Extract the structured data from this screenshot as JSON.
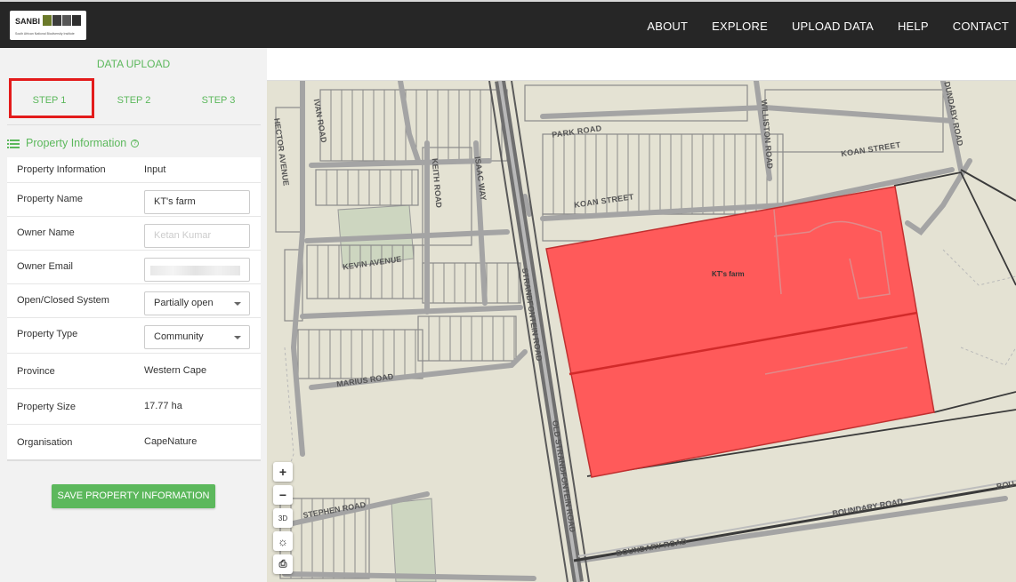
{
  "header": {
    "logo_abbr": "SANBI",
    "logo_sub": "South African National Biodiversity Institute",
    "nav": [
      "ABOUT",
      "EXPLORE",
      "UPLOAD DATA",
      "HELP",
      "CONTACT"
    ]
  },
  "panel": {
    "title": "DATA UPLOAD",
    "steps": [
      "STEP 1",
      "STEP 2",
      "STEP 3"
    ],
    "section_title": "Property Information",
    "table_head": {
      "label": "Property Information",
      "value": "Input"
    },
    "rows": [
      {
        "label": "Property Name",
        "value": "KT's farm"
      },
      {
        "label": "Owner Name",
        "value": "Ketan Kumar"
      },
      {
        "label": "Owner Email",
        "value": ""
      },
      {
        "label": "Open/Closed System",
        "value": "Partially open"
      },
      {
        "label": "Property Type",
        "value": "Community"
      },
      {
        "label": "Province",
        "value": "Western Cape"
      },
      {
        "label": "Property Size",
        "value": "17.77 ha"
      },
      {
        "label": "Organisation",
        "value": "CapeNature"
      }
    ],
    "save_label": "SAVE PROPERTY INFORMATION"
  },
  "map": {
    "parcel_label": "KT's farm",
    "roads": [
      "PARK ROAD",
      "KOAN STREET",
      "KOAN STREET",
      "IVAN ROAD",
      "KEITH ROAD",
      "ISAAC WAY",
      "KEVIN AVENUE",
      "MARIUS ROAD",
      "STRANDFONTEIN ROAD",
      "OLD STRANDFONTEIN ROAD",
      "WILLISTON ROAD",
      "DUNDABY ROAD",
      "STEPHEN ROAD",
      "BOUNDARY ROAD",
      "BOUNDARY ROAD",
      "BOUNDARY ROAD",
      "BOU",
      "HECTOR AVENUE"
    ],
    "controls": {
      "zoom_in": "+",
      "zoom_out": "−",
      "three_d": "3D"
    }
  },
  "colors": {
    "accent": "#5cb85c",
    "topbar": "#262626",
    "parcel": "#ff5a5a",
    "highlight": "#e31b1b"
  }
}
